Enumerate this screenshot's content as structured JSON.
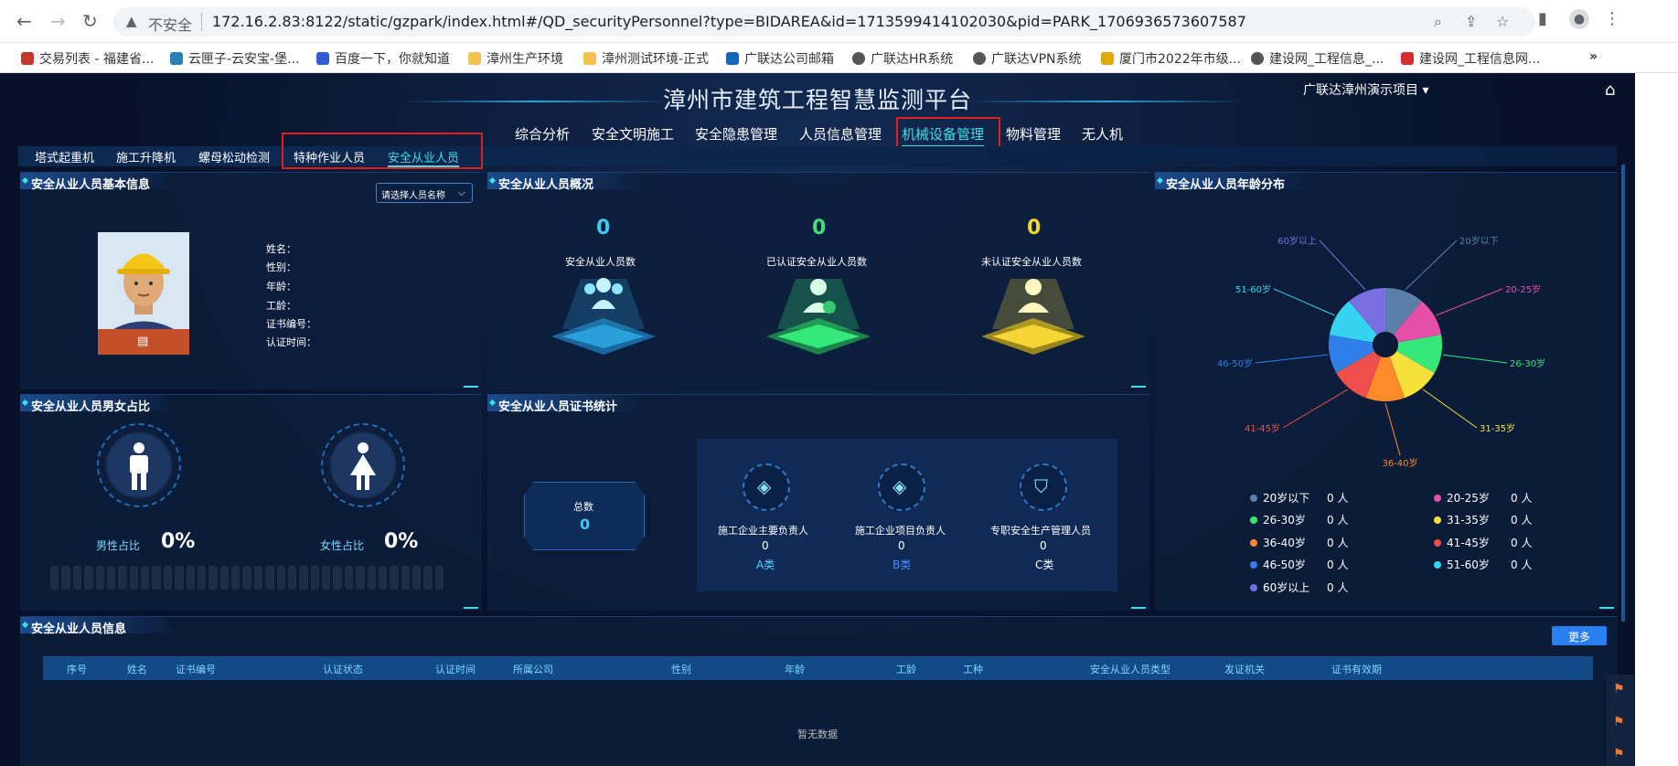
{
  "browser": {
    "insecure_label": "不安全",
    "url": "172.16.2.83:8122/static/gzpark/index.html#/QD_securityPersonnel?type=BIDAREA&id=1713599414102030&pid=PARK_1706936573607587",
    "bookmarks": [
      {
        "label": "交易列表 - 福建省...",
        "color": "#c0392b"
      },
      {
        "label": "云匣子-云安宝-堡...",
        "color": "#2980b9"
      },
      {
        "label": "百度一下，你就知道",
        "color": "#2f5bd3"
      },
      {
        "label": "漳州生产环境",
        "color": "#f2c14e"
      },
      {
        "label": "漳州测试环境-正式",
        "color": "#f2c14e"
      },
      {
        "label": "广联达公司邮箱",
        "color": "#1565c0"
      },
      {
        "label": "广联达HR系统",
        "color": "#555"
      },
      {
        "label": "广联达VPN系统",
        "color": "#555"
      },
      {
        "label": "厦门市2022年市级...",
        "color": "#e0a800"
      },
      {
        "label": "建设网_工程信息_...",
        "color": "#555"
      },
      {
        "label": "建设网_工程信息网...",
        "color": "#d32f2f"
      }
    ],
    "more_bookmarks": "»"
  },
  "app": {
    "title": "漳州市建筑工程智慧监测平台",
    "project": "广联达漳州演示项目",
    "project_chevron": "▾",
    "top_nav": [
      "综合分析",
      "安全文明施工",
      "安全隐患管理",
      "人员信息管理",
      "机械设备管理",
      "物料管理",
      "无人机"
    ],
    "active_top_nav": "机械设备管理",
    "sub_nav": [
      "塔式起重机",
      "施工升降机",
      "螺母松动检测",
      "特种作业人员",
      "安全从业人员"
    ],
    "active_sub_nav": "安全从业人员"
  },
  "basic_info": {
    "title": "安全从业人员基本信息",
    "select_placeholder": "请选择人员名称",
    "fields": [
      "姓名：",
      "性别：",
      "年龄：",
      "工龄：",
      "证书编号：",
      "认证时间："
    ]
  },
  "overview": {
    "title": "安全从业人员概况",
    "stats": [
      {
        "value": "0",
        "label": "安全从业人员数",
        "color": "#3fc9f0"
      },
      {
        "value": "0",
        "label": "已认证安全从业人员数",
        "color": "#3fe07a"
      },
      {
        "value": "0",
        "label": "未认证安全从业人员数",
        "color": "#f5d533"
      }
    ]
  },
  "age": {
    "title": "安全从业人员年龄分布",
    "pie_labels": [
      "20岁以下",
      "20-25岁",
      "26-30岁",
      "31-35岁",
      "36-40岁",
      "41-45岁",
      "46-50岁",
      "51-60岁",
      "60岁以上"
    ],
    "colors": [
      "#5b7fa8",
      "#e64fa8",
      "#35e87a",
      "#f5e13a",
      "#ff8a2a",
      "#f04d4d",
      "#2f7fe8",
      "#35d3f0",
      "#7a6fe0"
    ],
    "legend": [
      {
        "label": "20岁以下",
        "count": "0",
        "unit": "人"
      },
      {
        "label": "20-25岁",
        "count": "0",
        "unit": "人"
      },
      {
        "label": "26-30岁",
        "count": "0",
        "unit": "人"
      },
      {
        "label": "31-35岁",
        "count": "0",
        "unit": "人"
      },
      {
        "label": "36-40岁",
        "count": "0",
        "unit": "人"
      },
      {
        "label": "41-45岁",
        "count": "0",
        "unit": "人"
      },
      {
        "label": "46-50岁",
        "count": "0",
        "unit": "人"
      },
      {
        "label": "51-60岁",
        "count": "0",
        "unit": "人"
      },
      {
        "label": "60岁以上",
        "count": "0",
        "unit": "人"
      }
    ]
  },
  "gender": {
    "title": "安全从业人员男女占比",
    "male_label": "男性占比",
    "male_pct": "0%",
    "female_label": "女性占比",
    "female_pct": "0%"
  },
  "certs": {
    "title": "安全从业人员证书统计",
    "total_label": "总数",
    "total_value": "0",
    "items": [
      {
        "label": "施工企业主要负责人",
        "count": "0",
        "class": "A类",
        "color": "#4fd0ff"
      },
      {
        "label": "施工企业项目负责人",
        "count": "0",
        "class": "B类",
        "color": "#4a8cff"
      },
      {
        "label": "专职安全生产管理人员",
        "count": "0",
        "class": "C类",
        "color": "#ffffff"
      }
    ]
  },
  "table": {
    "title": "安全从业人员信息",
    "more": "更多",
    "columns": [
      "序号",
      "姓名",
      "证书编号",
      "认证状态",
      "认证时间",
      "所属公司",
      "性别",
      "年龄",
      "工龄",
      "工种",
      "安全从业人员类型",
      "发证机关",
      "证书有效期"
    ],
    "empty": "暂无数据"
  }
}
